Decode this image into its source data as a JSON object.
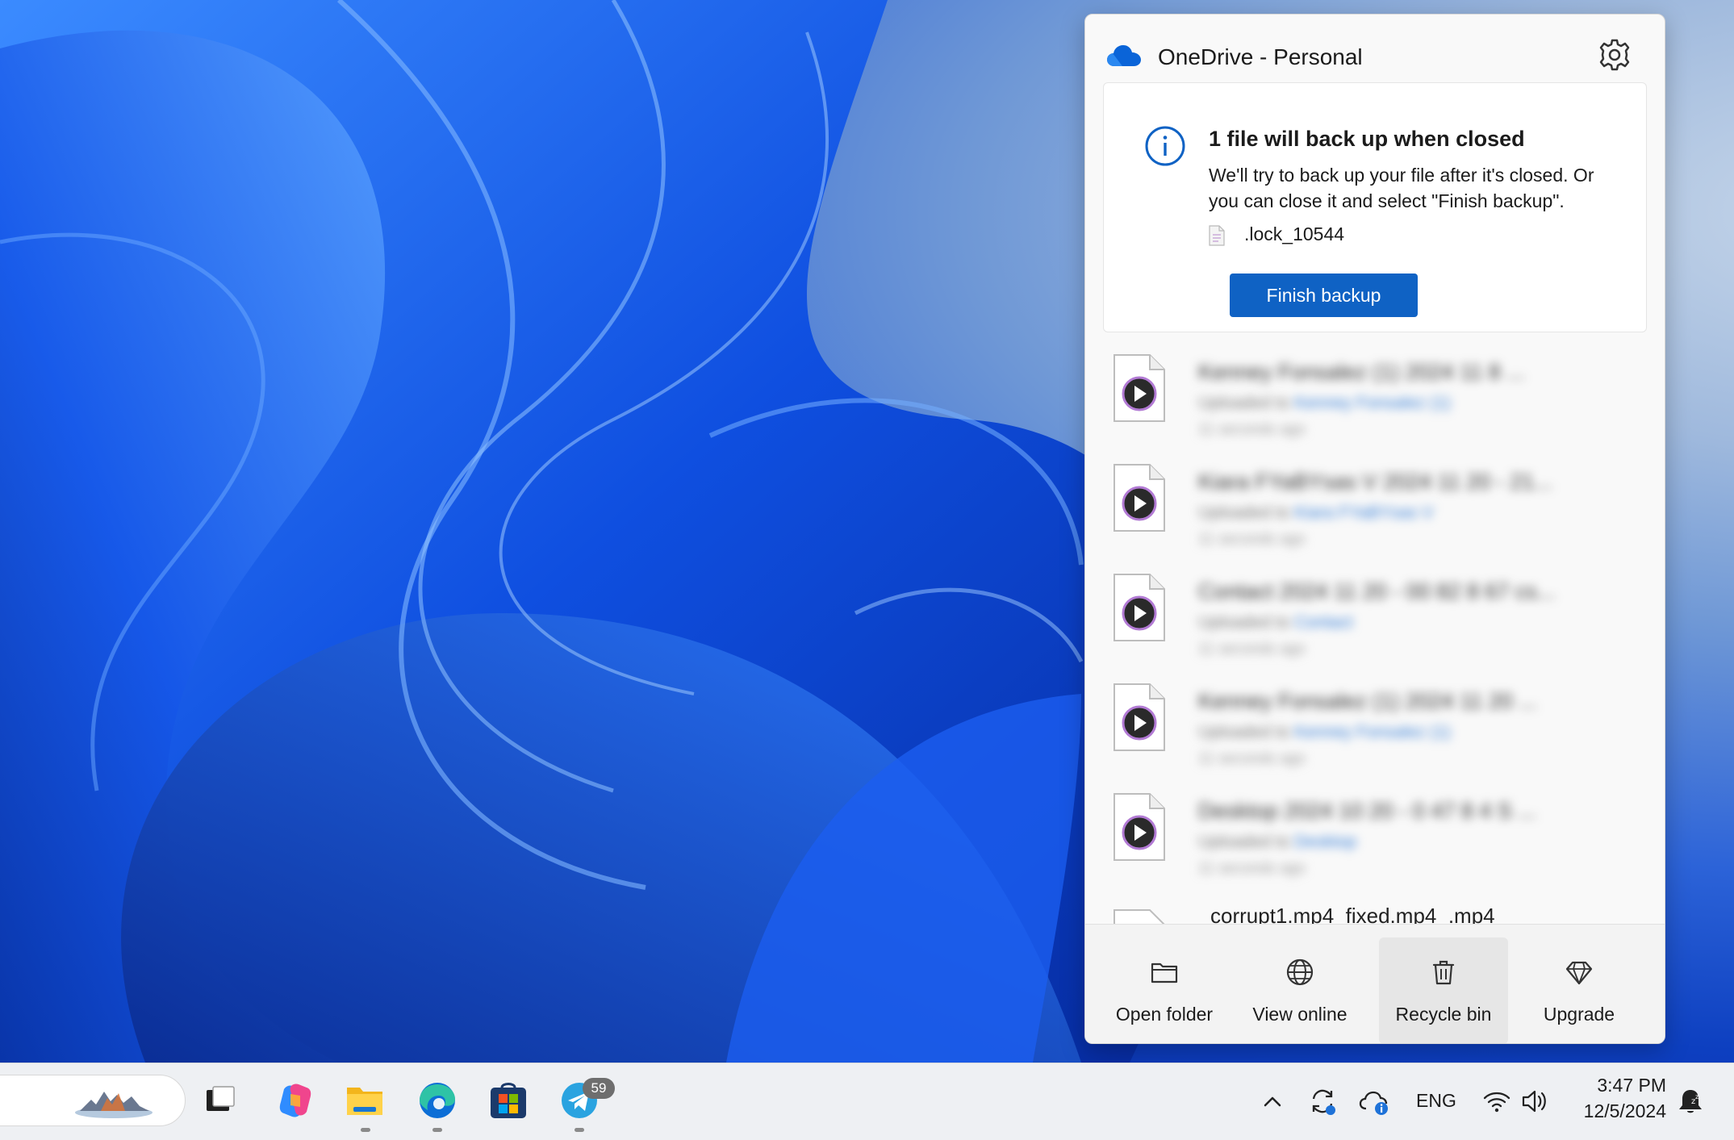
{
  "onedrive": {
    "title": "OneDrive - Personal",
    "notice": {
      "title": "1 file will back up when closed",
      "body": "We'll try to back up your file after it's closed. Or you can close it and select \"Finish backup\".",
      "file_name": ".lock_10544",
      "button_label": "Finish backup"
    },
    "activity": [
      {
        "name": "Kenney Fonsalez (1) 2024 11 8 ...",
        "status": "Uploaded to",
        "folder": "Kenney Fonsalez (1)",
        "time": "11 seconds ago"
      },
      {
        "name": "Kiara FYaBYsas V 2024 11 20 - 21...",
        "status": "Uploaded to",
        "folder": "Kiara FYaBYsas V",
        "time": "11 seconds ago"
      },
      {
        "name": "Contact 2024 11 20 - 00 82 8 67 cs...",
        "status": "Uploaded to",
        "folder": "Contact",
        "time": "11 seconds ago"
      },
      {
        "name": "Kenney Fonsalez (1) 2024 11 20 ...",
        "status": "Uploaded to",
        "folder": "Kenney Fonsalez (1)",
        "time": "11 seconds ago"
      },
      {
        "name": "Desktop 2024 10 20 - 0 47 8 4 S ...",
        "status": "Uploaded to",
        "folder": "Desktop",
        "time": "11 seconds ago"
      }
    ],
    "partial_item": "corrupt1.mp4_fixed.mp4_.mp4",
    "footer": {
      "open_folder": "Open folder",
      "view_online": "View online",
      "recycle_bin": "Recycle bin",
      "upgrade": "Upgrade"
    }
  },
  "taskbar": {
    "telegram_badge": "59",
    "language": "ENG",
    "time": "3:47 PM",
    "date": "12/5/2024"
  },
  "colors": {
    "accent": "#0f62c4",
    "panel_bg": "#f9f9f9",
    "taskbar_bg": "#eef0f3"
  }
}
